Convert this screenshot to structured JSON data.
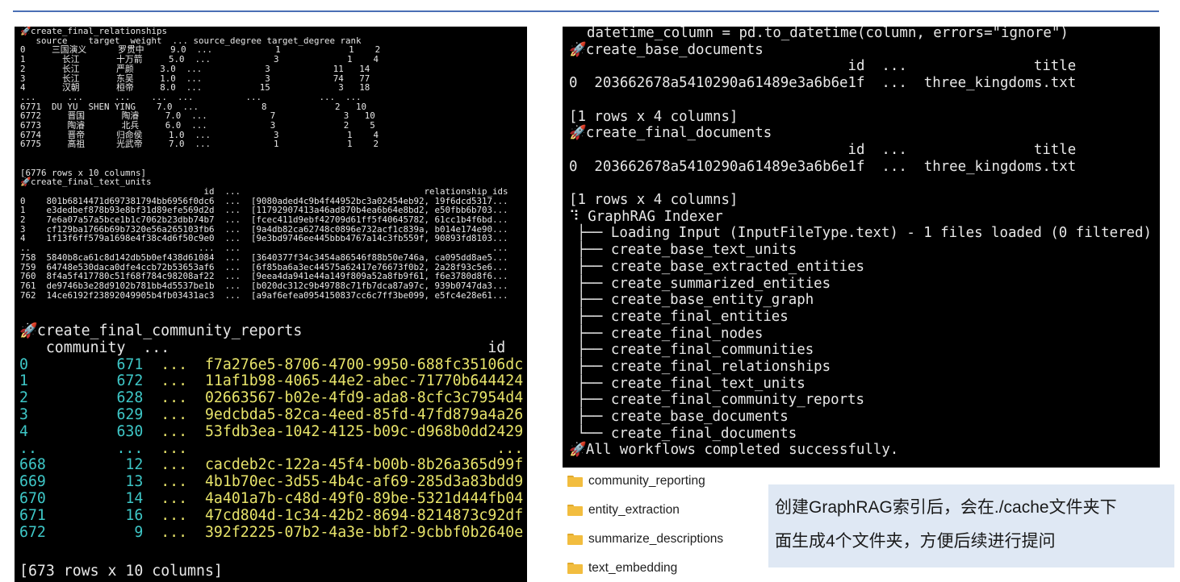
{
  "panel_a": {
    "title1": "create_final_relationships",
    "rel_header": "   source    target  weight  ... source_degree target_degree rank",
    "rel_rows": [
      "0     三国演义      罗贯中     9.0  ...            1             1    2",
      "1       长江       十万箭     5.0  ...            3             1    4",
      "2       长江       严颜     3.0  ...            3            11   14",
      "3       长江       东吴     1.0  ...            3            74   77",
      "4       汉朝       桓帝     8.0  ...           15             3   18",
      "...      ...      ...    ...  ...          ...           ...  ...",
      "6771  DU YU  SHEN YING    7.0  ...            8             2   10",
      "6772     晋国       陶濬     7.0  ...            7             3   10",
      "6773     陶濬       北兵     6.0  ...            3             2    5",
      "6774     晋帝      归命侯     1.0  ...            3             1    4",
      "6775     高祖      光武帝     7.0  ...            1             1    2"
    ],
    "rel_summary": "[6776 rows x 10 columns]",
    "title2": "create_final_text_units",
    "tu_header": "                                   id  ...                                   relationship_ids",
    "tu_rows": [
      "0    801b6814471d697381794bb6956f0dc6  ...  [9080aded4c9b4f44952bc3a02454eb92, 19f6dcd5317...",
      "1    e3dedbef878b93e8bf31d89efe569d2d  ...  [11792907413a46ad870b4ea6b64e8bd2, e50fbb6b703...",
      "2    7e6a07a57a5bce1b1c7062b23dbb74b7  ...  [fcec411d9ebf42709d61ff5f40645782, 61cc1b4f6bd...",
      "3    cf129ba1766b69b7320e56a265103fb6  ...  [9a4db82ca62748c0896e732acf1c839a, b014e174e90...",
      "4    1f13f6ff579a1698e4f38c4d6f50c9e0  ...  [9e3bd9746ee445bbb4767a14c3fb559f, 90893fd8103...",
      "..                                ...  ...                                                ...",
      "758  5840b8ca61c8d142db5b0ef438d61084  ...  [3640377f34c3454a86546f88b50e746a, ca095dd8ae5...",
      "759  64748e530daca0dfe4ccb72b53653af6  ...  [6f85ba6a3ec44575a62417e76673f0b2, 2a28f93c5e6...",
      "760  8f4a5f417780c51f68f784c98208af22  ...  [9eea4da941e44a149f809a52a8fb9f61, f6e3780d8f6...",
      "761  de9746b3e28d9102b781bb4d5537be1b  ...  [b020dc312c9b49788c71fb7dca87a97c, 939b0747da3...",
      "762  14ce6192f23892049905b4fb03431ac3  ...  [a9af6efea0954150837cc6c7ff3be099, e5fc4e28e61..."
    ]
  },
  "panel_b": {
    "title": "create_final_community_reports",
    "header": "   community  ...                                    id",
    "rows": [
      {
        "idx": "0   ",
        "community": "       671",
        "dots": "  ...  ",
        "id": "f7a276e5-8706-4700-9950-688fc35106dc"
      },
      {
        "idx": "1   ",
        "community": "       672",
        "dots": "  ...  ",
        "id": "11af1b98-4065-44e2-abec-71770b644424"
      },
      {
        "idx": "2   ",
        "community": "       628",
        "dots": "  ...  ",
        "id": "02663567-b02e-4fd9-ada8-8cfc3c7954d4"
      },
      {
        "idx": "3   ",
        "community": "       629",
        "dots": "  ...  ",
        "id": "9edcbda5-82ca-4eed-85fd-47fd879a4a26"
      },
      {
        "idx": "4   ",
        "community": "       630",
        "dots": "  ...  ",
        "id": "53fdb3ea-1042-4125-b09c-d968b0dd2429"
      },
      {
        "idx": "..  ",
        "community": "       ...",
        "dots": "  ...  ",
        "id": "                                 ..."
      },
      {
        "idx": "668 ",
        "community": "        12",
        "dots": "  ...  ",
        "id": "cacdeb2c-122a-45f4-b00b-8b26a365d99f"
      },
      {
        "idx": "669 ",
        "community": "        13",
        "dots": "  ...  ",
        "id": "4b1b70ec-3d55-4b4c-af69-285d3a83bdd9"
      },
      {
        "idx": "670 ",
        "community": "        14",
        "dots": "  ...  ",
        "id": "4a401a7b-c48d-49f0-89be-5321d444fb04"
      },
      {
        "idx": "671 ",
        "community": "        16",
        "dots": "  ...  ",
        "id": "47cd804d-1c34-42b2-8694-8214873c92df"
      },
      {
        "idx": "672 ",
        "community": "         9",
        "dots": "  ...  ",
        "id": "392f2225-07b2-4a3e-bbf2-9cbbf0b2640e"
      }
    ],
    "summary": "[673 rows x 10 columns]"
  },
  "panel_c": {
    "line0": "datetime_column = pd.to_datetime(column, errors=\"ignore\")",
    "title1": "create_base_documents",
    "header1": "                                 id  ...               title",
    "row1": "0  203662678a5410290a61489e3a6b6e1f  ...  three_kingdoms.txt",
    "summary1": "[1 rows x 4 columns]",
    "title2": "create_final_documents",
    "header2": "                                 id  ...               title",
    "row2": "0  203662678a5410290a61489e3a6b6e1f  ...  three_kingdoms.txt",
    "summary2": "[1 rows x 4 columns]",
    "indexer_title": "⠹ GraphRAG Indexer",
    "tree": [
      "├── Loading Input (InputFileType.text) - 1 files loaded (0 filtered)",
      "├── create_base_text_units",
      "├── create_base_extracted_entities",
      "├── create_summarized_entities",
      "├── create_base_entity_graph",
      "├── create_final_entities",
      "├── create_final_nodes",
      "├── create_final_communities",
      "├── create_final_relationships",
      "├── create_final_text_units",
      "├── create_final_community_reports",
      "├── create_base_documents",
      "└── create_final_documents"
    ],
    "done": "All workflows completed successfully."
  },
  "folders": [
    "community_reporting",
    "entity_extraction",
    "summarize_descriptions",
    "text_embedding"
  ],
  "note": {
    "line1": "创建GraphRAG索引后，会在./cache文件夹下",
    "line2": "面生成4个文件夹，方便后续进行提问"
  },
  "icons": {
    "rocket": "🚀",
    "folder": "folder-icon"
  },
  "colors": {
    "green": "#4ec94e",
    "cyan": "#3ec7c7",
    "yellow": "#e7e36a",
    "terminal_bg": "#000000",
    "note_bg": "#dfe8f4",
    "rule": "#4a6fb5"
  }
}
